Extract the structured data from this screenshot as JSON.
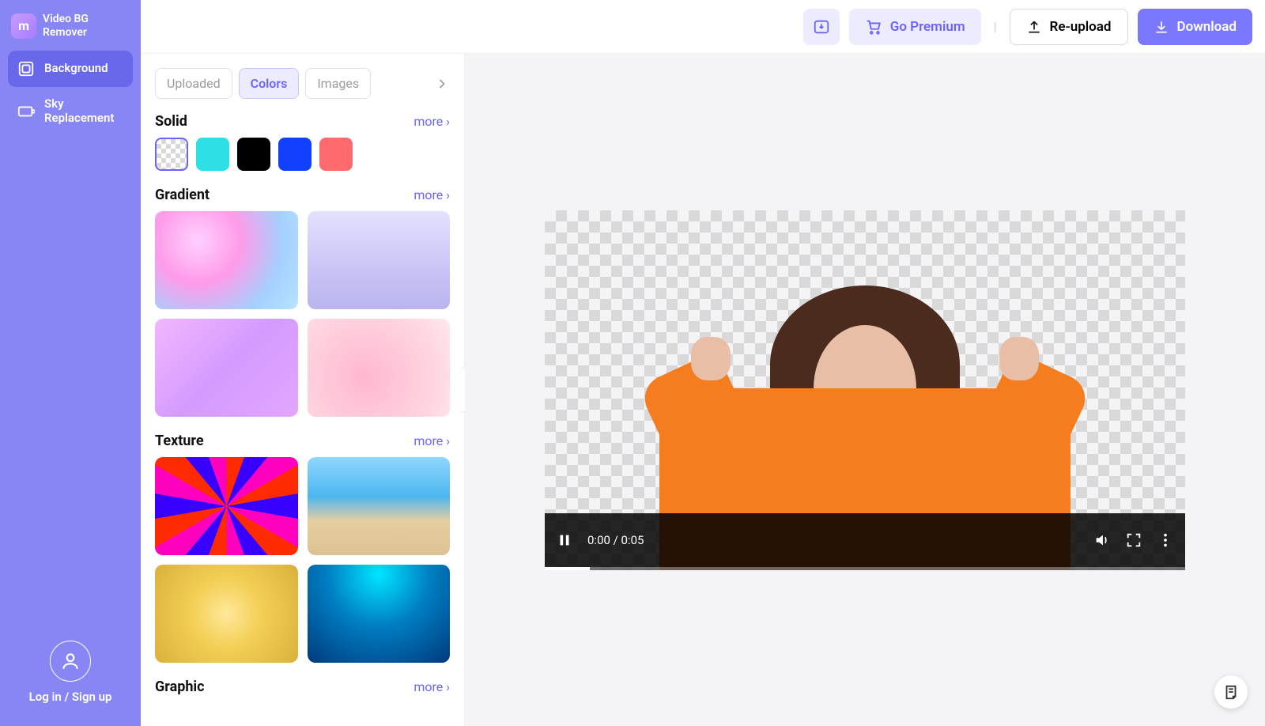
{
  "app": {
    "title_line1": "Video BG",
    "title_line2": "Remover"
  },
  "sidebar": {
    "items": [
      {
        "label": "Background",
        "icon": "background-icon"
      },
      {
        "label": "Sky Replacement",
        "icon": "sky-replacement-icon"
      }
    ],
    "login": "Log in / Sign up"
  },
  "topbar": {
    "premium": "Go Premium",
    "reupload": "Re-upload",
    "download": "Download"
  },
  "panel": {
    "tabs": [
      {
        "label": "Uploaded",
        "active": false
      },
      {
        "label": "Colors",
        "active": true
      },
      {
        "label": "Images",
        "active": false
      }
    ],
    "sections": {
      "solid": {
        "title": "Solid",
        "more": "more ›",
        "colors": [
          {
            "name": "transparent",
            "selected": true
          },
          {
            "name": "cyan",
            "value": "#2ce0e6"
          },
          {
            "name": "black",
            "value": "#000000"
          },
          {
            "name": "blue",
            "value": "#1141ff"
          },
          {
            "name": "coral",
            "value": "#ff6a6f"
          }
        ]
      },
      "gradient": {
        "title": "Gradient",
        "more": "more ›",
        "thumbs": [
          "pink-iridescent",
          "lavender-waves",
          "purple-swirl",
          "pink-soft"
        ]
      },
      "texture": {
        "title": "Texture",
        "more": "more ›",
        "thumbs": [
          "kaleidoscope",
          "beach-palms",
          "gold-glitter",
          "blue-particles"
        ]
      },
      "graphic": {
        "title": "Graphic",
        "more": "more ›"
      }
    }
  },
  "video": {
    "time_current": "0:00",
    "time_total": "0:05",
    "time_display": "0:00 / 0:05"
  }
}
